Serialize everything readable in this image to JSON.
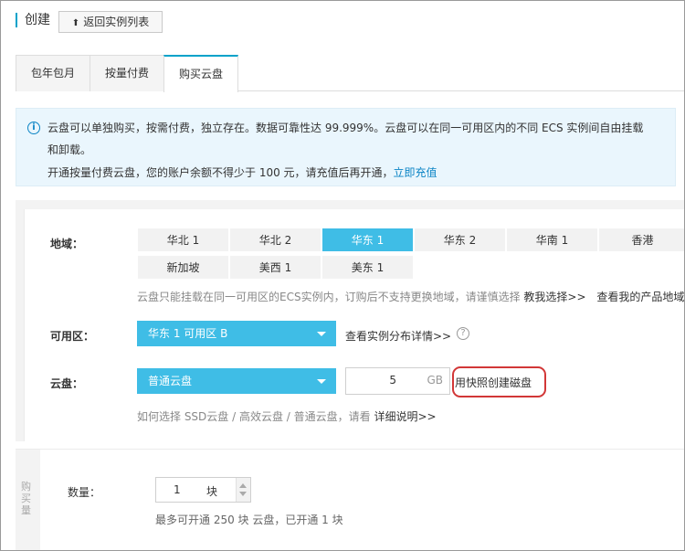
{
  "header": {
    "title": "创建",
    "back_label": "返回实例列表"
  },
  "tabs": [
    {
      "label": "包年包月"
    },
    {
      "label": "按量付费"
    },
    {
      "label": "购买云盘"
    }
  ],
  "notice": {
    "line1": "云盘可以单独购买，按需付费，独立存在。数据可靠性达 99.999%。云盘可以在同一可用区内的不同 ECS 实例间自由挂载",
    "line2": "和卸载。",
    "line3_text": "开通按量付费云盘，您的账户余额不得少于 100 元，请充值后再开通，",
    "line3_link": "立即充值"
  },
  "region": {
    "label": "地域：",
    "options": [
      "华北 1",
      "华北 2",
      "华东 1",
      "华东 2",
      "华南 1",
      "香港",
      "新加坡",
      "美西 1",
      "美东 1"
    ],
    "selected": "华东 1",
    "hint": "云盘只能挂载在同一可用区的ECS实例内，订购后不支持更换地域，请谨慎选择",
    "help_link": "教我选择>>",
    "product_link": "查看我的产品地域"
  },
  "zone": {
    "label": "可用区：",
    "value": "华东 1 可用区 B",
    "link": "查看实例分布详情>>"
  },
  "disk": {
    "label": "云盘：",
    "type": "普通云盘",
    "size": "5",
    "unit": "GB",
    "snapshot_link": "用快照创建磁盘",
    "hint": "如何选择 SSD云盘 / 高效云盘 / 普通云盘，请看",
    "hint_link": "详细说明>>"
  },
  "purchase": {
    "side_label": "购买量",
    "qty_label": "数量：",
    "qty_value": "1",
    "qty_unit": "块",
    "hint": "最多可开通 250 块 云盘，已开通 1 块"
  },
  "colors": {
    "accent": "#3fbde6",
    "link": "#0b84c5",
    "notice_bg": "#eaf6fd",
    "highlight": "#d23737"
  }
}
